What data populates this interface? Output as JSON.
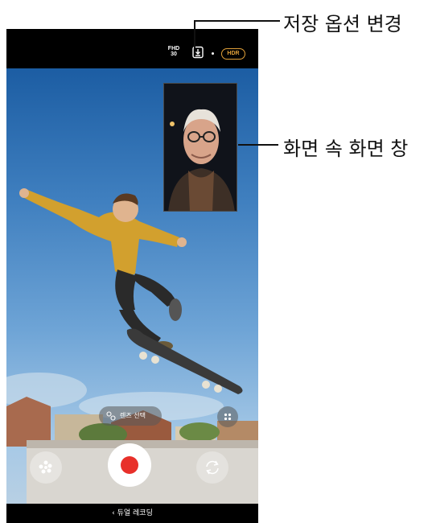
{
  "topbar": {
    "resolution_label": "FHD",
    "fps_label": "30",
    "save_icon": "save-download-icon",
    "hdr_label": "HDR"
  },
  "controls": {
    "lens_select_label": "렌즈 선택",
    "lens_icon": "lens-circles-icon",
    "grid_icon": "grid-dots-icon",
    "effect_icon": "sparkle-effect-icon",
    "switch_icon": "camera-switch-icon",
    "record_color": "#e8302a"
  },
  "bottombar": {
    "back_symbol": "‹",
    "mode_label": "듀얼 레코딩"
  },
  "callouts": {
    "save_options": "저장 옵션 변경",
    "pip_window": "화면 속 화면 창"
  },
  "colors": {
    "hdr_accent": "#e3a23a"
  }
}
